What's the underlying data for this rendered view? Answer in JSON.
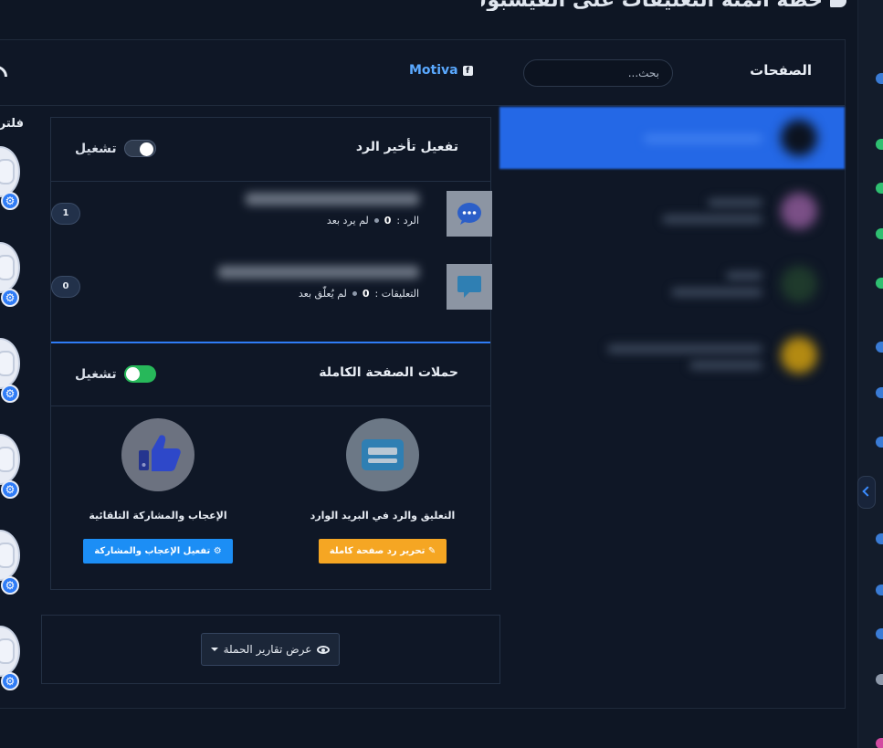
{
  "page_title": "خطة أتمتة التعليقات على الفيسبوك",
  "colors": {
    "background": "#0e1624",
    "panel": "#0f1726",
    "accent_blue": "#2468e6",
    "brand_link": "#5aa9ff",
    "toggle_on": "#27b85a",
    "orange_button": "#f5a623",
    "blue_button": "#1c8ef5"
  },
  "topbar": {
    "pages_title": "الصفحات",
    "search_placeholder": "بحث...",
    "brand_name": "Motiva",
    "brand_icon": "facebook-icon",
    "feed_icon": "rss-icon"
  },
  "left_column": {
    "filter_label": "فلتر",
    "avatar_icon": "user-avatar",
    "badge_icon": "gear-icon"
  },
  "delay_panel": {
    "title": "تفعيل تأخير الرد",
    "toggle_label": "تشغيل",
    "toggle_state": "off",
    "rows": [
      {
        "icon": "message-dots-icon",
        "meta_label": "الرد :",
        "meta_value": "0",
        "status": "لم يرد بعد",
        "count": "1"
      },
      {
        "icon": "comment-icon",
        "meta_label": "التعليقات :",
        "meta_value": "0",
        "status": "لم يُعلّق بعد",
        "count": "0"
      }
    ]
  },
  "campaigns_panel": {
    "title": "حملات الصفحة الكاملة",
    "toggle_label": "تشغيل",
    "toggle_state": "on",
    "features": [
      {
        "icon": "card-icon",
        "label": "التعليق والرد في البريد الوارد",
        "button_label": "تحرير رد صفحة كاملة",
        "button_icon": "edit-icon"
      },
      {
        "icon": "thumbs-up-icon",
        "label": "الإعجاب والمشاركة التلقائية",
        "button_label": "تفعيل الإعجاب والمشاركة",
        "button_icon": "gear-icon"
      }
    ]
  },
  "reports_button": {
    "label": "عرض تقارير الحملة",
    "icon": "eye-icon"
  }
}
